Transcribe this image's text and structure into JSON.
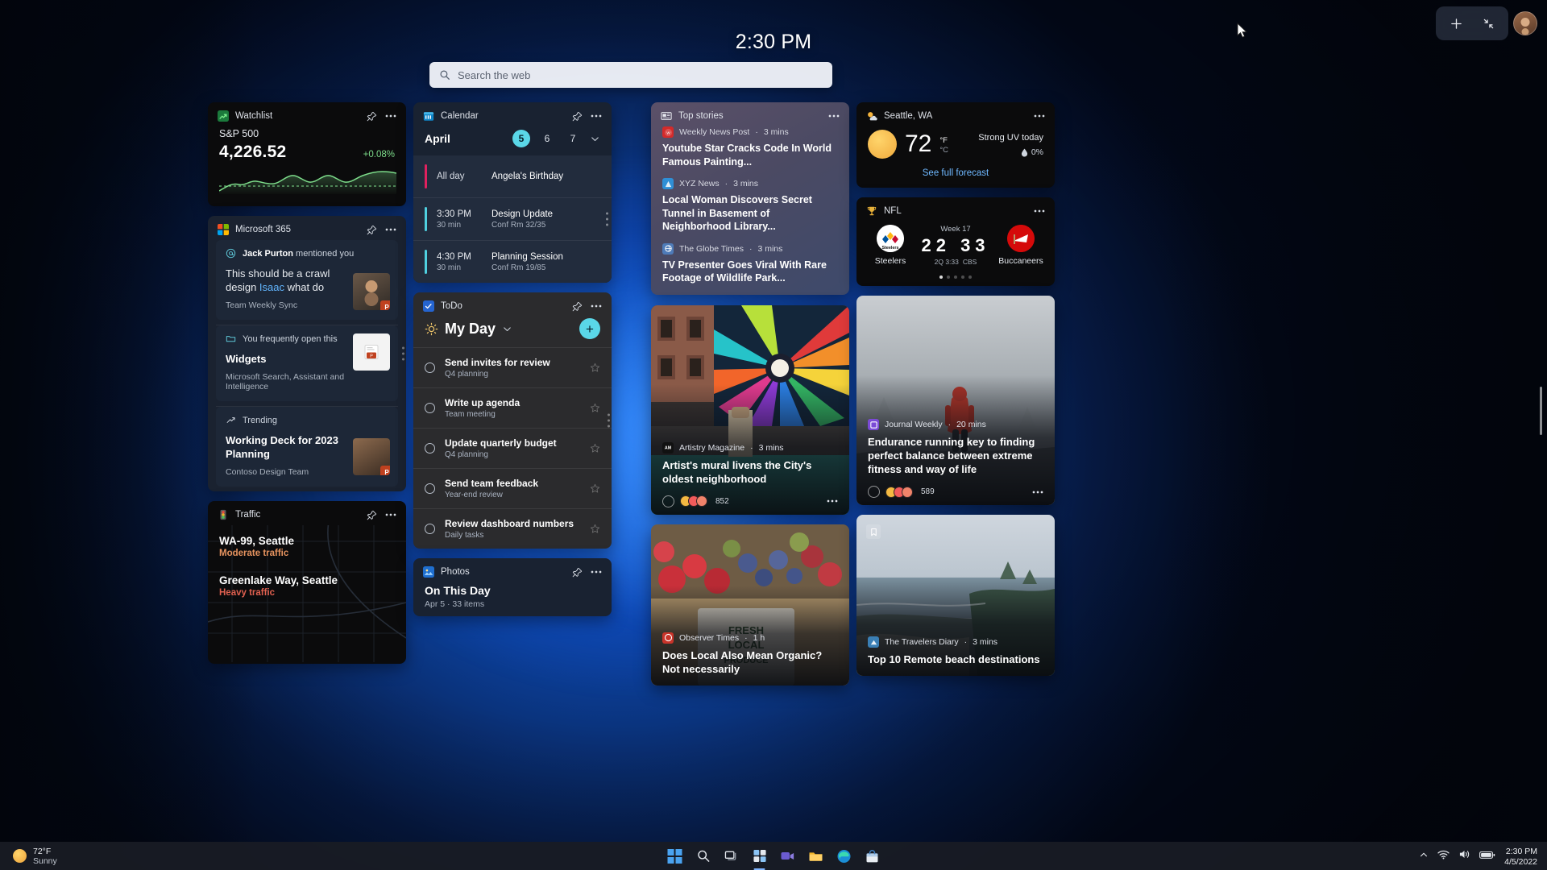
{
  "topbar": {
    "add_label": "Add widgets",
    "collapse_label": "Collapse",
    "avatar_label": "Account"
  },
  "header": {
    "clock": "2:30 PM",
    "search_placeholder": "Search the web",
    "search_value": ""
  },
  "widgets": {
    "watchlist": {
      "title": "Watchlist",
      "icon": "stocks-icon",
      "symbol": "S&P 500",
      "value": "4,226.52",
      "delta": "+0.08%",
      "delta_color": "#7ddc8a"
    },
    "microsoft365": {
      "title": "Microsoft 365",
      "icon": "microsoft-365-icon",
      "mention": {
        "label_prefix": "",
        "person": "Jack Purton",
        "label_suffix": " mentioned you",
        "body_pre": "This should be a crawl design ",
        "body_mention": "Isaac",
        "body_post": " what do",
        "meta": "Team Weekly Sync"
      },
      "frequent": {
        "label": "You frequently open this",
        "title": "Widgets",
        "meta": "Microsoft Search, Assistant and Intelligence",
        "file_type": "PPT"
      },
      "trending": {
        "label": "Trending",
        "title": "Working Deck for 2023 Planning",
        "meta": "Contoso Design Team",
        "file_type": "PPT"
      }
    },
    "traffic": {
      "title": "Traffic",
      "icon": "traffic-light-icon",
      "routes": [
        {
          "road": "WA-99, Seattle",
          "status": "Moderate traffic",
          "severity": "moderate"
        },
        {
          "road": "Greenlake Way, Seattle",
          "status": "Heavy traffic",
          "severity": "heavy"
        }
      ]
    },
    "calendar": {
      "title": "Calendar",
      "icon": "calendar-icon",
      "month": "April",
      "days": [
        "5",
        "6",
        "7"
      ],
      "selected_day": "5",
      "events": [
        {
          "time": "All day",
          "duration": "",
          "name": "Angela's Birthday",
          "location": "",
          "color": "#e0215f"
        },
        {
          "time": "3:30 PM",
          "duration": "30 min",
          "name": "Design Update",
          "location": "Conf Rm 32/35",
          "color": "#4fd0e0"
        },
        {
          "time": "4:30 PM",
          "duration": "30 min",
          "name": "Planning Session",
          "location": "Conf Rm 19/85",
          "color": "#4fd0e0"
        }
      ]
    },
    "todo": {
      "title": "ToDo",
      "icon": "todo-icon",
      "list_name": "My Day",
      "add_label": "+",
      "tasks": [
        {
          "name": "Send invites for review",
          "group": "Q4 planning"
        },
        {
          "name": "Write up agenda",
          "group": "Team meeting"
        },
        {
          "name": "Update quarterly budget",
          "group": "Q4 planning"
        },
        {
          "name": "Send team feedback",
          "group": "Year-end review"
        },
        {
          "name": "Review dashboard numbers",
          "group": "Daily tasks"
        }
      ]
    },
    "photos": {
      "title": "Photos",
      "icon": "photos-icon",
      "heading": "On This Day",
      "meta": "Apr 5 · 33 items"
    },
    "top_stories": {
      "title": "Top stories",
      "icon": "news-icon",
      "items": [
        {
          "source": "Weekly News Post",
          "time": "3 mins",
          "headline": "Youtube Star Cracks Code In World Famous Painting...",
          "logo_color": "#d32b2b"
        },
        {
          "source": "XYZ News",
          "time": "3 mins",
          "headline": "Local Woman Discovers Secret Tunnel in Basement of Neighborhood Library...",
          "logo_color": "#2f8fd6"
        },
        {
          "source": "The Globe Times",
          "time": "3 mins",
          "headline": "TV Presenter Goes Viral With Rare Footage of Wildlife Park...",
          "logo_color": "#4e7bb8"
        }
      ]
    },
    "weather": {
      "title": "Seattle, WA",
      "icon": "partly-cloudy-icon",
      "temperature": "72",
      "unit_primary": "°F",
      "unit_secondary": "°C",
      "uv_note": "Strong UV today",
      "precip": "0%",
      "link": "See full forecast"
    },
    "nfl": {
      "title": "NFL",
      "icon": "trophy-icon",
      "week": "Week 17",
      "home_team": "Steelers",
      "home_score": "22",
      "away_team": "Buccaneers",
      "away_score": "33",
      "broadcast_left": "2Q 3:33",
      "broadcast_right": "CBS",
      "page_index": 1,
      "page_count": 5
    }
  },
  "feed_cards": [
    {
      "id": "mural",
      "source": "Artistry Magazine",
      "time": "3 mins",
      "headline": "Artist's mural livens the City's oldest neighborhood",
      "reactions": "852",
      "has_comment_icon": true,
      "logo_color": "#111111",
      "art": "street-mural"
    },
    {
      "id": "running",
      "source": "Journal Weekly",
      "time": "20 mins",
      "headline": "Endurance running key to finding perfect balance between extreme fitness and way of life",
      "reactions": "589",
      "has_comment_icon": true,
      "logo_color": "#7b4ad6",
      "art": "runner-fog"
    },
    {
      "id": "organic",
      "source": "Observer Times",
      "time": "1 h",
      "headline": "Does Local Also Mean Organic? Not necessarily",
      "reactions": "",
      "has_comment_icon": false,
      "logo_color": "#c9342a",
      "art": "fresh-produce"
    },
    {
      "id": "beaches",
      "source": "The Travelers Diary",
      "time": "3 mins",
      "headline": "Top 10 Remote beach destinations",
      "reactions": "",
      "has_comment_icon": false,
      "logo_color": "#3a7fb5",
      "art": "coastal-beach"
    }
  ],
  "taskbar": {
    "weather_temp": "72°F",
    "weather_desc": "Sunny",
    "apps": [
      {
        "name": "start-button"
      },
      {
        "name": "search-button"
      },
      {
        "name": "task-view-button"
      },
      {
        "name": "widgets-button"
      },
      {
        "name": "teams-chat-button"
      },
      {
        "name": "file-explorer-button"
      },
      {
        "name": "edge-button"
      },
      {
        "name": "store-button"
      }
    ],
    "clock_time": "2:30 PM",
    "clock_date": "4/5/2022"
  },
  "chart_data": {
    "type": "line",
    "title": "S&P 500",
    "series": [
      {
        "name": "S&P 500",
        "values": [
          18,
          21,
          19,
          22,
          20,
          24,
          22,
          26,
          25,
          30,
          27,
          33,
          31,
          36,
          34,
          38,
          36,
          41,
          39,
          44,
          42,
          46,
          50,
          48,
          53,
          51,
          56,
          54,
          58,
          62
        ]
      }
    ],
    "baseline": 24,
    "line_color": "#7ddc8a",
    "grid": false,
    "xlabel": "",
    "ylabel": ""
  }
}
